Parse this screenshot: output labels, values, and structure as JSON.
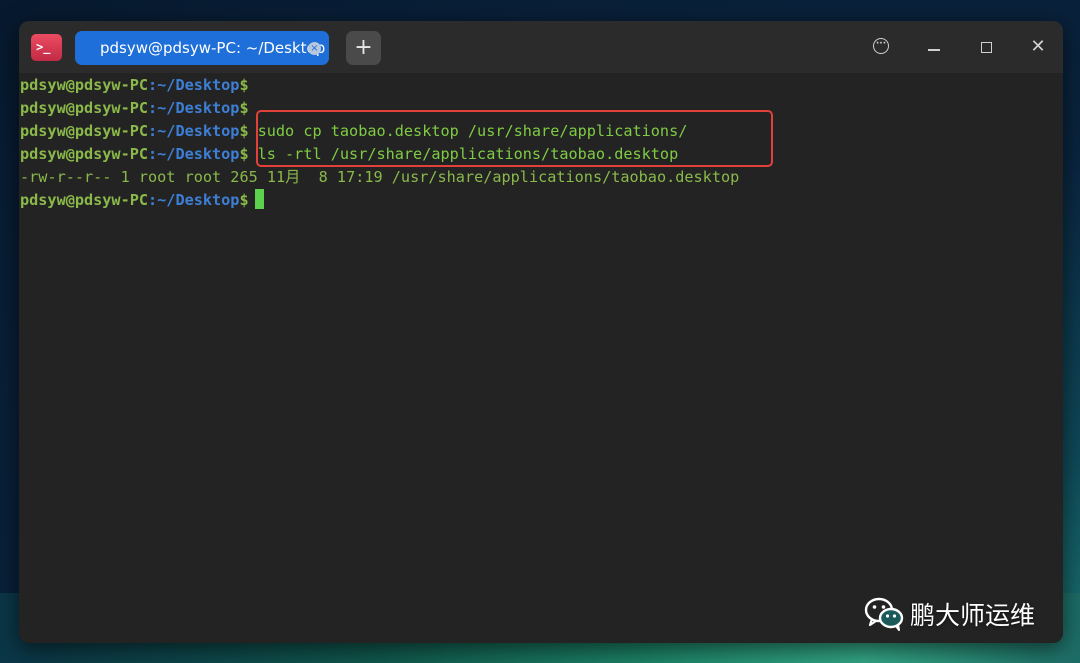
{
  "window": {
    "tab_title": "pdsyw@pdsyw-PC: ~/Desktop",
    "app_icon_glyph": ">_",
    "new_tab_glyph": "+",
    "controls": [
      "more-icon",
      "minimize-icon",
      "maximize-icon",
      "close-icon"
    ],
    "tab_close_glyph": "×",
    "close_glyph": "✕",
    "menu_glyph": "•••"
  },
  "terminal": {
    "prompt_user": "pdsyw@pdsyw-PC",
    "prompt_path": ":~/Desktop",
    "prompt_symbol": "$",
    "lines": [
      {
        "command": ""
      },
      {
        "command": ""
      },
      {
        "command": "sudo cp taobao.desktop /usr/share/applications/"
      },
      {
        "command": "ls -rtl /usr/share/applications/taobao.desktop"
      }
    ],
    "output": "-rw-r--r-- 1 root root 265 11月  8 17:19 /usr/share/applications/taobao.desktop",
    "highlight_color": "#e2413a",
    "colors": {
      "user": "#8ab94a",
      "path": "#3e7fd6",
      "command": "#7fcc44",
      "cursor": "#5bd14e",
      "tab": "#1e6fd9"
    }
  },
  "watermark": {
    "text": "鹏大师运维"
  }
}
